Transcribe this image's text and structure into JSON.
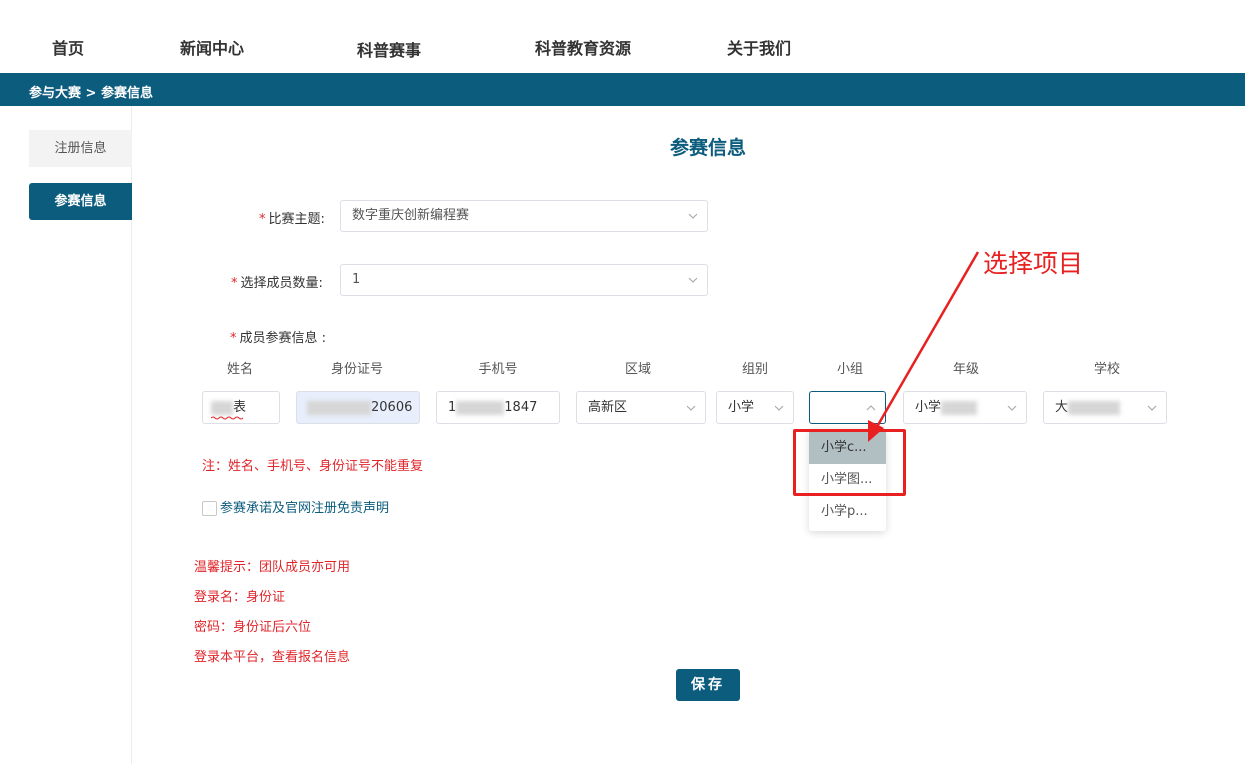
{
  "nav": {
    "items": [
      "首页",
      "新闻中心",
      "科普赛事",
      "科普教育资源",
      "关于我们"
    ]
  },
  "breadcrumb": "参与大赛 > 参赛信息",
  "sidebar": {
    "items": [
      {
        "label": "注册信息",
        "active": false
      },
      {
        "label": "参赛信息",
        "active": true
      }
    ]
  },
  "page_title": "参赛信息",
  "form": {
    "theme": {
      "label": "比赛主题:",
      "value": "数字重庆创新编程赛"
    },
    "member_count": {
      "label": "选择成员数量:",
      "value": "1"
    },
    "member_info_label": "成员参赛信息 :",
    "columns": [
      "姓名",
      "身份证号",
      "手机号",
      "区域",
      "组别",
      "小组",
      "年级",
      "学校"
    ],
    "row": {
      "name": "表",
      "id_number": "20606",
      "phone_prefix": "1",
      "phone_suffix": "1847",
      "region": "高新区",
      "group": "小学",
      "subgroup": "",
      "grade": "小学",
      "school": "大"
    },
    "subgroup_options": [
      "小学c...",
      "小学图...",
      "小学p..."
    ],
    "note": "注：姓名、手机号、身份证号不能重复",
    "agreement": "参赛承诺及官网注册免责声明",
    "tips": [
      "温馨提示：团队成员亦可用",
      "登录名：身份证",
      "密码：身份证后六位",
      "登录本平台，查看报名信息"
    ],
    "save_label": "保存"
  },
  "annotation": {
    "text": "选择项目",
    "color": "#e82020"
  },
  "colors": {
    "brand": "#0c5c7d",
    "warning": "#e0262b"
  }
}
